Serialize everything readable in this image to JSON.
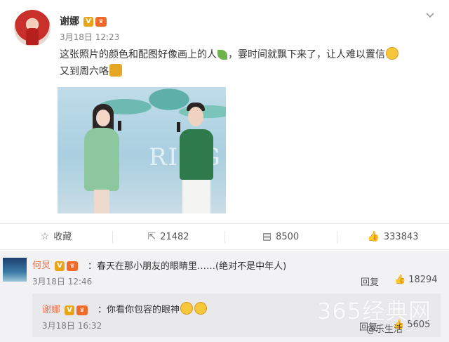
{
  "post": {
    "author": "谢娜",
    "timestamp": "3月18日 12:23",
    "text_line1": "这张照片的颜色和配图好像画上的人",
    "text_line1b": "，霎时间就飘下来了，让人难以置信",
    "text_line2": "又到周六咯",
    "image_overlay_text": "RING",
    "image_weibo_mark": "◉"
  },
  "actions": {
    "favorite_label": "收藏",
    "repost_count": "21482",
    "comment_count": "8500",
    "like_count": "333843"
  },
  "comment": {
    "author": "何炅",
    "text": "：春天在那小朋友的眼睛里……(绝对不是中年人)",
    "timestamp": "3月18日 12:46",
    "reply_label": "回复",
    "like_count": "18294"
  },
  "reply": {
    "author": "谢娜",
    "text": "：你看你包容的眼神",
    "timestamp": "3月18日 16:32",
    "reply_label": "回复",
    "like_count": "5605"
  },
  "watermark": {
    "site": "365经典网",
    "handle": "@乐生活"
  },
  "colors": {
    "name_orange": "#eb7350",
    "verified_badge": "#e8a317"
  }
}
